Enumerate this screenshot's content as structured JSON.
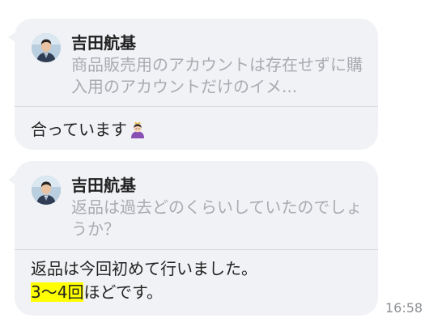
{
  "messages": [
    {
      "quote": {
        "name": "吉田航基",
        "text": "商品販売用のアカウントは存在せずに購入用のアカウントだけのイメ..."
      },
      "reply": {
        "text": "合っています",
        "emoji": "person-with-crown-emoji"
      }
    },
    {
      "quote": {
        "name": "吉田航基",
        "text": "返品は過去どのくらいしていたのでしょうか？"
      },
      "reply": {
        "line1": "返品は今回初めて行いました。",
        "highlight": "3〜4回",
        "line2_rest": "ほどです。"
      }
    }
  ],
  "timestamp": "16:58",
  "colors": {
    "bubble": "#f1f2f5",
    "quote_text": "#a9abb1",
    "highlight": "#ffff00"
  }
}
